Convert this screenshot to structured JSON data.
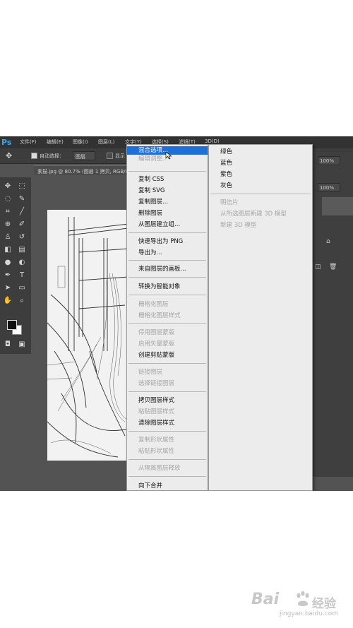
{
  "app": {
    "logo": "Ps",
    "menubar": [
      "文件(F)",
      "编辑(E)",
      "图像(I)",
      "图层(L)",
      "文字(Y)",
      "选择(S)",
      "滤镜(T)",
      "3D(D)"
    ],
    "options_bar": {
      "auto_select_label": "自动选择：",
      "auto_select_value": "图层",
      "show_transform_label": "显示"
    },
    "doc_tab": "素描.jpg @ 80.7% (图层 1 拷贝, RGB/8)",
    "right_panel": {
      "opacity_value": "100%",
      "fill_value": "100%"
    }
  },
  "context_menu": {
    "items": [
      {
        "label": "混合选项...",
        "state": "highlighted"
      },
      {
        "label": "编辑调整...",
        "state": "disabled"
      },
      {
        "label": "复制 CSS",
        "state": "enabled"
      },
      {
        "label": "复制 SVG",
        "state": "enabled"
      },
      {
        "label": "复制图层...",
        "state": "enabled"
      },
      {
        "label": "删除图层",
        "state": "enabled"
      },
      {
        "label": "从图层建立组...",
        "state": "enabled"
      },
      {
        "label": "快速导出为 PNG",
        "state": "enabled"
      },
      {
        "label": "导出为...",
        "state": "enabled"
      },
      {
        "label": "来自图层的画板...",
        "state": "enabled"
      },
      {
        "label": "转换为智能对象",
        "state": "enabled"
      },
      {
        "label": "栅格化图层",
        "state": "disabled"
      },
      {
        "label": "栅格化图层样式",
        "state": "disabled"
      },
      {
        "label": "停用图层蒙版",
        "state": "disabled"
      },
      {
        "label": "启用矢量蒙版",
        "state": "disabled"
      },
      {
        "label": "创建剪贴蒙版",
        "state": "enabled"
      },
      {
        "label": "链接图层",
        "state": "disabled"
      },
      {
        "label": "选择链接图层",
        "state": "disabled"
      },
      {
        "label": "拷贝图层样式",
        "state": "enabled"
      },
      {
        "label": "粘贴图层样式",
        "state": "disabled"
      },
      {
        "label": "清除图层样式",
        "state": "enabled"
      },
      {
        "label": "复制形状属性",
        "state": "disabled"
      },
      {
        "label": "粘贴形状属性",
        "state": "disabled"
      },
      {
        "label": "从隔离图层释放",
        "state": "disabled"
      },
      {
        "label": "向下合并",
        "state": "enabled"
      }
    ]
  },
  "submenu": {
    "items": [
      {
        "label": "绿色",
        "state": "enabled"
      },
      {
        "label": "蓝色",
        "state": "enabled"
      },
      {
        "label": "紫色",
        "state": "enabled"
      },
      {
        "label": "灰色",
        "state": "enabled"
      },
      {
        "label": "明信片",
        "state": "disabled"
      },
      {
        "label": "从所选图层新建 3D 模型",
        "state": "disabled"
      },
      {
        "label": "新建 3D 模型",
        "state": "disabled"
      }
    ]
  },
  "watermark": {
    "brand_left": "Bai",
    "brand_right": "经验",
    "url": "jingyan.baidu.com"
  },
  "colors": {
    "highlight": "#1f6fd8",
    "workspace": "#535353",
    "ps_blue": "#31a8ff"
  }
}
